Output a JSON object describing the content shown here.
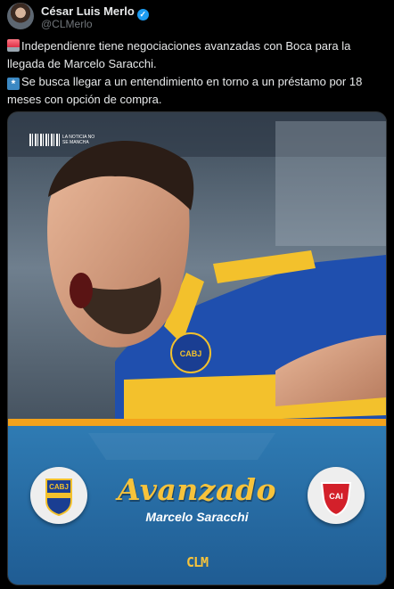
{
  "author": {
    "name": "César Luis Merlo",
    "handle": "@CLMerlo",
    "verified_badge": "✓"
  },
  "tweet": {
    "line1_text": "Independienre tiene negociaciones avanzadas con Boca para la llegada de Marcelo Saracchi.",
    "line1_emoji": "police-car-light",
    "line2_text": "Se busca llegar a un entendimiento en torno a un préstamo por 18 meses con opción de compra.",
    "line2_emoji": "keycap-asterisk"
  },
  "media": {
    "brand_text": "LA NOTICIA NO SE MANCHA",
    "status_word": "Avanzado",
    "player_name": "Marcelo Saracchi",
    "left_crest": "CABJ",
    "right_crest": "CAI",
    "footer_logo": "CLM",
    "jersey_crest": "CABJ",
    "colors": {
      "boca_blue": "#1f4fae",
      "boca_gold": "#f3c12c",
      "banner_blue": "#2d6fa8",
      "independiente_red": "#d3202a"
    }
  }
}
